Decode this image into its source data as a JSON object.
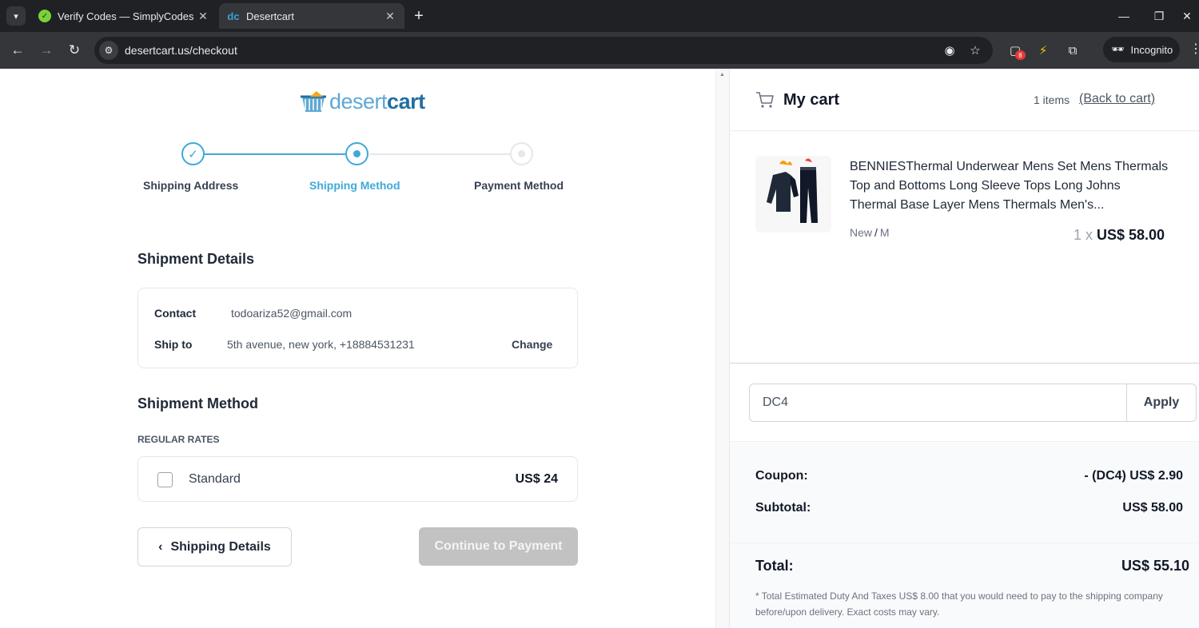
{
  "browser": {
    "tabs": [
      {
        "title": "Verify Codes — SimplyCodes",
        "active": false
      },
      {
        "title": "Desertcart",
        "active": true
      }
    ],
    "url": "desertcart.us/checkout",
    "extension_badge": "8",
    "incognito_label": "Incognito"
  },
  "logo": {
    "part1": "desert",
    "part2": "cart"
  },
  "steps": [
    {
      "label": "Shipping Address",
      "state": "done"
    },
    {
      "label": "Shipping Method",
      "state": "current"
    },
    {
      "label": "Payment Method",
      "state": "todo"
    }
  ],
  "shipment_details": {
    "title": "Shipment Details",
    "contact_label": "Contact",
    "contact_value": "todoariza52@gmail.com",
    "ship_to_label": "Ship to",
    "ship_to_value": "5th avenue, new york, +18884531231",
    "change_label": "Change"
  },
  "shipment_method": {
    "title": "Shipment Method",
    "rates_label": "REGULAR RATES",
    "options": [
      {
        "name": "Standard",
        "price": "US$ 24",
        "selected": false
      }
    ]
  },
  "buttons": {
    "back_label": "Shipping Details",
    "continue_label": "Continue to Payment"
  },
  "cart": {
    "title": "My cart",
    "count": "1 items",
    "back_to_cart": "(Back to cart)",
    "items": [
      {
        "name": "BENNIESThermal Underwear Mens Set Mens Thermals Top and Bottoms Long Sleeve Tops Long Johns Thermal Base Layer Mens Thermals Men's...",
        "condition": "New",
        "separator": "/",
        "size": "M",
        "qty": "1 x",
        "price": "US$ 58.00"
      }
    ],
    "coupon": {
      "value": "DC4",
      "apply_label": "Apply"
    },
    "totals": {
      "coupon_label": "Coupon:",
      "coupon_value": "- (DC4) US$ 2.90",
      "subtotal_label": "Subtotal:",
      "subtotal_value": "US$ 58.00",
      "total_label": "Total:",
      "total_value": "US$ 55.10"
    },
    "disclaimer": "* Total Estimated Duty And Taxes US$ 8.00 that you would need to pay to the shipping company before/upon delivery. Exact costs may vary."
  },
  "colors": {
    "accent": "#3fa9d9",
    "disabled_button": "#c2c2c2",
    "brand_dark": "#1f6fa3"
  }
}
